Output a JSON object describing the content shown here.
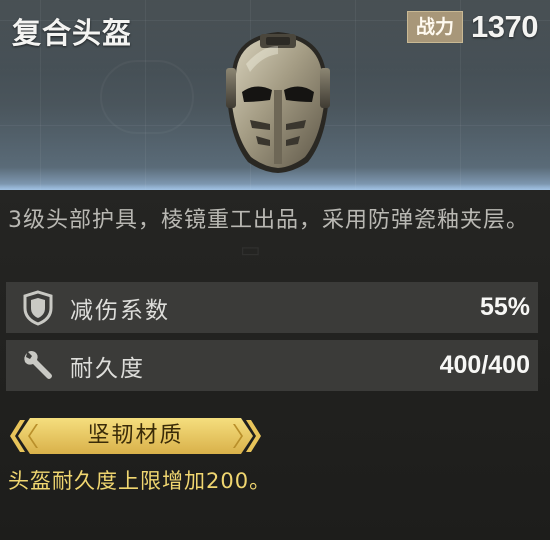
{
  "item": {
    "name": "复合头盔",
    "power_label": "战力",
    "power_value": "1370",
    "description": "3级头部护具，棱镜重工出品，采用防弹瓷釉夹层。"
  },
  "stats": [
    {
      "icon": "shield-icon",
      "label": "减伤系数",
      "value": "55%"
    },
    {
      "icon": "wrench-icon",
      "label": "耐久度",
      "value": "400/400"
    }
  ],
  "trait": {
    "name": "坚韧材质",
    "description": "头盔耐久度上限增加200。"
  },
  "colors": {
    "header_top": "#3d4549",
    "header_bottom": "#8aa7c4",
    "panel": "#1d1d1b",
    "stat_row": "#3b3b39",
    "power_badge": "#a89779",
    "trait_gold": "#e8c45a",
    "trait_text": "#f0d670"
  }
}
